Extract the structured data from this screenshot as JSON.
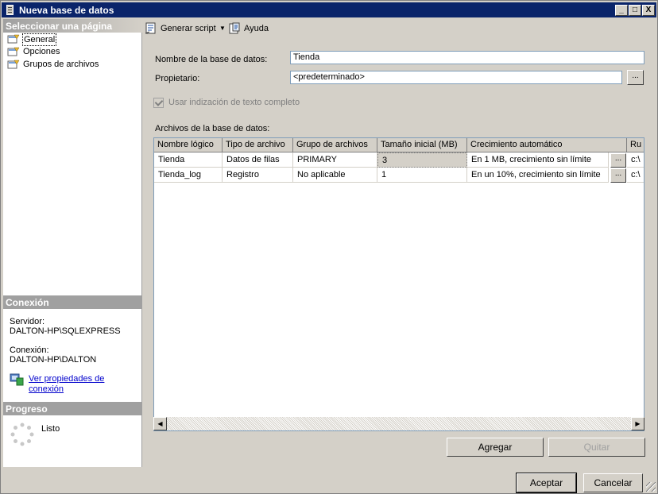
{
  "window": {
    "title": "Nueva base de datos",
    "controls": {
      "minimize": "_",
      "maximize": "□",
      "close": "X"
    }
  },
  "left_panel": {
    "select_page_header": "Seleccionar una página",
    "pages": [
      {
        "label": "General",
        "icon": "page-icon",
        "selected": true
      },
      {
        "label": "Opciones",
        "icon": "page-icon"
      },
      {
        "label": "Grupos de archivos",
        "icon": "page-icon"
      }
    ],
    "connection_header": "Conexión",
    "server_label": "Servidor:",
    "server_value": "DALTON-HP\\SQLEXPRESS",
    "connection_label": "Conexión:",
    "connection_value": "DALTON-HP\\DALTON",
    "view_properties_link_line1": "Ver propiedades de",
    "view_properties_link_line2": "conexión",
    "progress_header": "Progreso",
    "progress_status": "Listo"
  },
  "toolbar": {
    "generate_script": "Generar script",
    "help": "Ayuda"
  },
  "form": {
    "db_name_label": "Nombre de la base de datos:",
    "db_name_value": "Tienda",
    "owner_label": "Propietario:",
    "owner_value": "<predeterminado>",
    "ellipsis": "...",
    "fulltext_label": "Usar indización de texto completo",
    "fulltext_checked": true,
    "files_label": "Archivos de la base de datos:"
  },
  "files_grid": {
    "columns": [
      "Nombre lógico",
      "Tipo de archivo",
      "Grupo de archivos",
      "Tamaño inicial (MB)",
      "Crecimiento automático",
      "Ruta"
    ],
    "columns_visible": [
      "Nombre lógico",
      "Tipo de archivo",
      "Grupo de archivos",
      "Tamaño inicial (MB)",
      "Crecimiento automático",
      "Ru"
    ],
    "rows": [
      [
        "Tienda",
        "Datos de filas",
        "PRIMARY",
        "3",
        "En 1 MB, crecimiento sin límite",
        "c:\\"
      ],
      [
        "Tienda_log",
        "Registro",
        "No aplicable",
        "1",
        "En un 10%, crecimiento sin límite",
        "c:\\"
      ]
    ],
    "cell_button": "..."
  },
  "grid_buttons": {
    "add": "Agregar",
    "remove": "Quitar"
  },
  "dialog_buttons": {
    "ok": "Aceptar",
    "cancel": "Cancelar"
  }
}
